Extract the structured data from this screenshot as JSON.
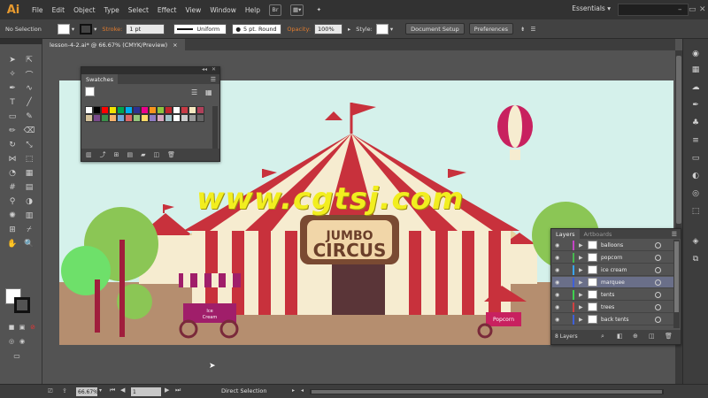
{
  "app": {
    "logo": "Ai",
    "workspace": "Essentials"
  },
  "menu": [
    "File",
    "Edit",
    "Object",
    "Type",
    "Select",
    "Effect",
    "View",
    "Window",
    "Help"
  ],
  "menu_icons": {
    "bridge": "Br"
  },
  "control_bar": {
    "selection": "No Selection",
    "stroke_label": "Stroke:",
    "stroke_weight": "1 pt",
    "stroke_profile": "Uniform",
    "brush": "5 pt. Round",
    "opacity_label": "Opacity:",
    "opacity_value": "100%",
    "style_label": "Style:",
    "document_setup": "Document Setup",
    "preferences": "Preferences"
  },
  "document_tab": {
    "title": "lesson-4-2.ai* @ 66.67% (CMYK/Preview)",
    "close": "×"
  },
  "swatches_panel": {
    "title": "Swatches",
    "colors": [
      "#ffffff",
      "#000000",
      "#ff0000",
      "#f2e200",
      "#00a651",
      "#00aeef",
      "#2e3192",
      "#ec008c",
      "#f7941d",
      "#8dc63f",
      "#c1272d",
      "#ffffff",
      "#c83a45",
      "#f4e8c1",
      "#b0405a",
      "#d4c29a",
      "#7a4b8c",
      "#3a8f4a",
      "#f6b26b",
      "#6fa8dc",
      "#e06666",
      "#93c47d",
      "#ffd966",
      "#8e7cc3",
      "#d5a6bd",
      "#a2c4c9",
      "#ffffff",
      "#cccccc",
      "#999999",
      "#666666"
    ]
  },
  "layers_panel": {
    "tabs": [
      "Layers",
      "Artboards"
    ],
    "layers": [
      {
        "name": "balloons",
        "color": "#c444c4"
      },
      {
        "name": "popcorn",
        "color": "#47b84f"
      },
      {
        "name": "ice cream",
        "color": "#3aa4f0"
      },
      {
        "name": "marquee",
        "color": "#3f60d8"
      },
      {
        "name": "tents",
        "color": "#3fd04f"
      },
      {
        "name": "trees",
        "color": "#d04141"
      },
      {
        "name": "back tents",
        "color": "#3f60d8"
      }
    ],
    "selected": "marquee",
    "count_label": "8 Layers"
  },
  "artwork": {
    "sign_top": "JUMBO",
    "sign_bottom": "CIRCUS",
    "ice_cream_sign_top": "Ice",
    "ice_cream_sign_bottom": "Cream",
    "popcorn_sign": "Popcorn",
    "colors": {
      "sky": "#d5f1eb",
      "ground": "#b58e6f",
      "red": "#c8313c",
      "cream": "#f6ecd0",
      "tree": "#8bc655"
    }
  },
  "watermark": "www.cgtsj.com",
  "status_bar": {
    "zoom": "66.67%",
    "artboard": "1",
    "mode": "Direct Selection"
  }
}
